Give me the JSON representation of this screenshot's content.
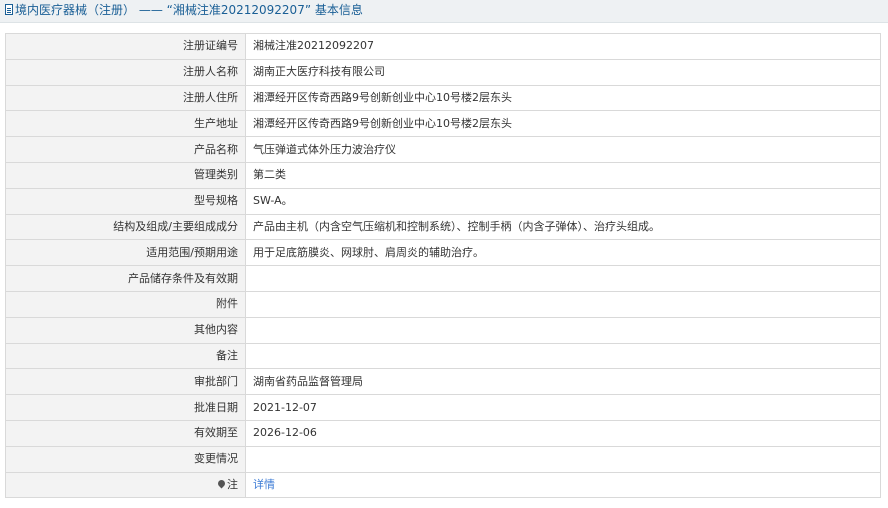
{
  "header": {
    "icon": "document-icon",
    "title": "境内医疗器械（注册） —— “湘械注准20212092207” 基本信息",
    "colors": {
      "title": "#1a5f96",
      "background": "#eef1f3"
    }
  },
  "rows": [
    {
      "label": "注册证编号",
      "value": "湘械注准20212092207"
    },
    {
      "label": "注册人名称",
      "value": "湖南正大医疗科技有限公司"
    },
    {
      "label": "注册人住所",
      "value": "湘潭经开区传奇西路9号创新创业中心10号楼2层东头"
    },
    {
      "label": "生产地址",
      "value": "湘潭经开区传奇西路9号创新创业中心10号楼2层东头"
    },
    {
      "label": "产品名称",
      "value": "气压弹道式体外压力波治疗仪"
    },
    {
      "label": "管理类别",
      "value": "第二类"
    },
    {
      "label": "型号规格",
      "value": "SW-A。"
    },
    {
      "label": "结构及组成/主要组成成分",
      "value": "产品由主机（内含空气压缩机和控制系统）、控制手柄（内含子弹体）、治疗头组成。"
    },
    {
      "label": "适用范围/预期用途",
      "value": "用于足底筋膜炎、网球肘、肩周炎的辅助治疗。"
    },
    {
      "label": "产品储存条件及有效期",
      "value": ""
    },
    {
      "label": "附件",
      "value": ""
    },
    {
      "label": "其他内容",
      "value": ""
    },
    {
      "label": "备注",
      "value": ""
    },
    {
      "label": "审批部门",
      "value": "湖南省药品监督管理局"
    },
    {
      "label": "批准日期",
      "value": "2021-12-07"
    },
    {
      "label": "有效期至",
      "value": "2026-12-06"
    },
    {
      "label": "变更情况",
      "value": ""
    }
  ],
  "note_row": {
    "icon": "map-pin-icon",
    "label": "注",
    "link_text": "详情",
    "link_color": "#3a7ad5"
  }
}
